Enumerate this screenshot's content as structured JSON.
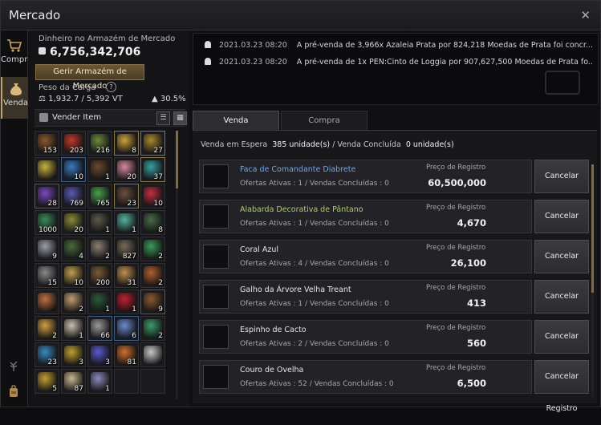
{
  "window": {
    "title": "Mercado",
    "close_glyph": "✕"
  },
  "rail": {
    "compra_label": "Compra",
    "venda_label": "Venda",
    "icons": [
      "cart-icon",
      "money-bag-icon",
      "tree-icon",
      "backpack-icon"
    ]
  },
  "warehouse": {
    "money_label": "Dinheiro no Armazém de Mercado",
    "money_value": "6,756,342,706",
    "manage_button": "Gerir Armazém de Mercado",
    "weight_label": "Peso da Carga",
    "help_glyph": "?",
    "weight_value": "1,932.7 / 5,392 VT",
    "weight_pct": "30.5%"
  },
  "vender": {
    "label": "Vender Item",
    "list_glyph": "☰",
    "grid_glyph": "▦"
  },
  "inventory": [
    {
      "q": "153",
      "c": "#8a5a2a"
    },
    {
      "q": "203",
      "c": "#c0392b"
    },
    {
      "q": "216",
      "c": "#6a8a3a"
    },
    {
      "q": "8",
      "c": "#c9a23a"
    },
    {
      "q": "27",
      "c": "#a8892f"
    },
    {
      "q": "",
      "c": "#c8b040"
    },
    {
      "q": "10",
      "c": "#3a7ac0"
    },
    {
      "q": "1",
      "c": "#6a4a30"
    },
    {
      "q": "20",
      "c": "#d48aa0"
    },
    {
      "q": "37",
      "c": "#3aa0a0"
    },
    {
      "q": "28",
      "c": "#7a4ac0"
    },
    {
      "q": "769",
      "c": "#5a5ab0"
    },
    {
      "q": "765",
      "c": "#4aa04a"
    },
    {
      "q": "23",
      "c": "#6a5040"
    },
    {
      "q": "10",
      "c": "#c03040"
    },
    {
      "q": "1000",
      "c": "#3a8a5a"
    },
    {
      "q": "20",
      "c": "#8a8a3a"
    },
    {
      "q": "1",
      "c": "#5a5a4a"
    },
    {
      "q": "1",
      "c": "#5ab0a0"
    },
    {
      "q": "8",
      "c": "#4a6a4a"
    },
    {
      "q": "9",
      "c": "#9aa0a8"
    },
    {
      "q": "4",
      "c": "#4a6a3a"
    },
    {
      "q": "2",
      "c": "#8a8070"
    },
    {
      "q": "827",
      "c": "#7a6a5a"
    },
    {
      "q": "2",
      "c": "#3a9a5a"
    },
    {
      "q": "15",
      "c": "#8a8a8a"
    },
    {
      "q": "10",
      "c": "#c0a050"
    },
    {
      "q": "200",
      "c": "#7a5a3a"
    },
    {
      "q": "31",
      "c": "#c09050"
    },
    {
      "q": "2",
      "c": "#b06030"
    },
    {
      "q": "",
      "c": "#c07040"
    },
    {
      "q": "2",
      "c": "#c0a070"
    },
    {
      "q": "1",
      "c": "#2a5a3a"
    },
    {
      "q": "1",
      "c": "#c02030"
    },
    {
      "q": "9",
      "c": "#8a5a30"
    },
    {
      "q": "2",
      "c": "#d0a040"
    },
    {
      "q": "1",
      "c": "#c8c0b0"
    },
    {
      "q": "66",
      "c": "#9a9a9a"
    },
    {
      "q": "6",
      "c": "#6a8ad0"
    },
    {
      "q": "2",
      "c": "#3a9a6a"
    },
    {
      "q": "23",
      "c": "#3a8ac0"
    },
    {
      "q": "3",
      "c": "#c0a030"
    },
    {
      "q": "3",
      "c": "#5a5ad0"
    },
    {
      "q": "81",
      "c": "#d07030"
    },
    {
      "q": "",
      "c": "#c8c8c8"
    },
    {
      "q": "5",
      "c": "#c0a030"
    },
    {
      "q": "87",
      "c": "#c8b890"
    },
    {
      "q": "1",
      "c": "#8a8ac0"
    },
    {
      "q": "",
      "c": ""
    },
    {
      "q": "",
      "c": ""
    }
  ],
  "notices": [
    {
      "time": "2021.03.23 08:20",
      "text": "A pré-venda de 3,966x Azaleia Prata por 824,218 Moedas de Prata foi concr..."
    },
    {
      "time": "2021.03.23 08:20",
      "text": "A pré-venda de 1x PEN:Cinto de Loggia por 907,627,500 Moedas de Prata fo..."
    }
  ],
  "tabs": {
    "venda": "Venda",
    "compra": "Compra"
  },
  "status": {
    "waiting_label": "Venda em Espera",
    "waiting_value": "385 unidade(s)",
    "sep": "/",
    "done_label": "Venda Concluída",
    "done_value": "0 unidade(s)"
  },
  "price_label": "Preço de Registro",
  "cancel_label": "Cancelar Registro",
  "listings": [
    {
      "name": "Faca de Comandante Diabrete",
      "grade": "blue",
      "sub": "Ofertas Ativas : 1 / Vendas Concluídas : 0",
      "price": "60,500,000",
      "icon": "knife-icon"
    },
    {
      "name": "Alabarda Decorativa de Pântano",
      "grade": "green",
      "sub": "Ofertas Ativas : 1 / Vendas Concluídas : 0",
      "price": "4,670",
      "icon": "halberd-icon"
    },
    {
      "name": "Coral Azul",
      "grade": "",
      "sub": "Ofertas Ativas : 4 / Vendas Concluídas : 0",
      "price": "26,100",
      "icon": "coral-icon"
    },
    {
      "name": "Galho da Árvore Velha Treant",
      "grade": "",
      "sub": "Ofertas Ativas : 1 / Vendas Concluídas : 0",
      "price": "413",
      "icon": "branch-icon"
    },
    {
      "name": "Espinho de Cacto",
      "grade": "",
      "sub": "Ofertas Ativas : 2 / Vendas Concluídas : 0",
      "price": "560",
      "icon": "cactus-thorn-icon"
    },
    {
      "name": "Couro de Ovelha",
      "grade": "",
      "sub": "Ofertas Ativas : 52 / Vendas Concluídas : 0",
      "price": "6,500",
      "icon": "sheepskin-icon"
    }
  ]
}
